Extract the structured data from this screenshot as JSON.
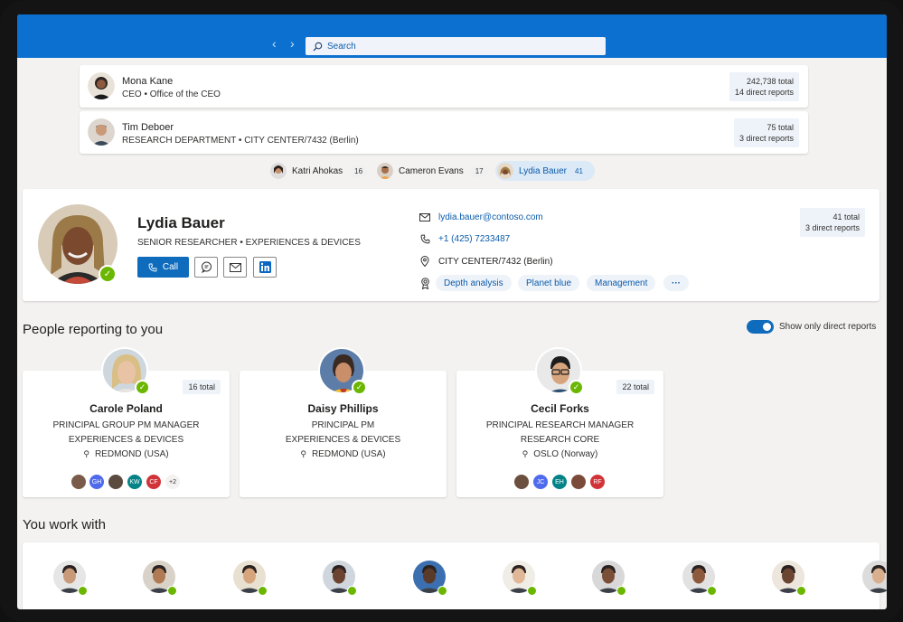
{
  "search": {
    "placeholder": "Search"
  },
  "chain": [
    {
      "name": "Mona Kane",
      "subtitle": "CEO • Office of the CEO",
      "total": "242,738 total",
      "direct": "14 direct reports"
    },
    {
      "name": "Tim Deboer",
      "subtitle": "RESEARCH DEPARTMENT • CITY CENTER/7432 (Berlin)",
      "total": "75 total",
      "direct": "3 direct reports"
    }
  ],
  "breadcrumbs": [
    {
      "name": "Katri Ahokas",
      "count": "16"
    },
    {
      "name": "Cameron Evans",
      "count": "17"
    },
    {
      "name": "Lydia Bauer",
      "count": "41"
    }
  ],
  "profile": {
    "name": "Lydia Bauer",
    "title": "SENIOR RESEARCHER •  EXPERIENCES & DEVICES",
    "call_label": "Call",
    "email": "lydia.bauer@contoso.com",
    "phone": "+1 (425) 7233487",
    "location": "CITY CENTER/7432 (Berlin)",
    "skills": [
      "Depth analysis",
      "Planet blue",
      "Management"
    ],
    "more": "···",
    "total": "41 total",
    "direct": "3 direct reports"
  },
  "reporting": {
    "title": "People reporting to you",
    "toggle_label": "Show only direct reports",
    "cards": [
      {
        "name": "Carole Poland",
        "line1": "PRINCIPAL GROUP PM MANAGER",
        "line2": "EXPERIENCES & DEVICES",
        "location": "REDMOND (USA)",
        "total": "16 total",
        "reports": [
          {
            "initials": "",
            "color": "#7a5a48"
          },
          {
            "initials": "GH",
            "color": "#4f6bed"
          },
          {
            "initials": "",
            "color": "#5a4a40"
          },
          {
            "initials": "KW",
            "color": "#038387"
          },
          {
            "initials": "CF",
            "color": "#d13438"
          },
          {
            "initials": "+2",
            "color": "#f3f2f1"
          }
        ]
      },
      {
        "name": "Daisy Phillips",
        "line1": "PRINCIPAL PM",
        "line2": "EXPERIENCES & DEVICES",
        "location": "REDMOND (USA)",
        "total": "",
        "reports": []
      },
      {
        "name": "Cecil Forks",
        "line1": "PRINCIPAL RESEARCH MANAGER",
        "line2": "RESEARCH CORE",
        "location": "OSLO (Norway)",
        "total": "22 total",
        "reports": [
          {
            "initials": "",
            "color": "#6b4f3f"
          },
          {
            "initials": "JC",
            "color": "#4f6bed"
          },
          {
            "initials": "EH",
            "color": "#038387"
          },
          {
            "initials": "",
            "color": "#7a4a3a"
          },
          {
            "initials": "RF",
            "color": "#d13438"
          }
        ]
      }
    ]
  },
  "work_with": {
    "title": "You work with"
  }
}
